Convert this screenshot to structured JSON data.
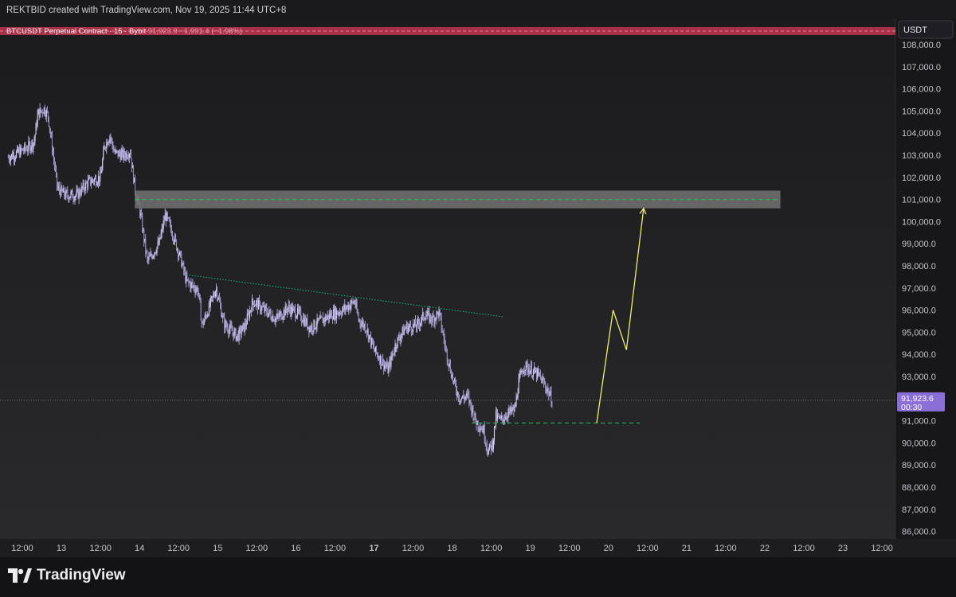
{
  "header": {
    "credit": "REKTBID created with TradingView.com, Nov 19, 2025 11:44 UTC+8"
  },
  "legend": {
    "symbol": "BTCUSDT Perpetual Contract · 15 · Bybit",
    "price": "91,923.9",
    "change": "−1,991.4 (−1.98%)"
  },
  "currency_label": "USDT",
  "price_tag": {
    "price": "91,923.6",
    "countdown": "00:30"
  },
  "footer": {
    "logo_text": "TradingView"
  },
  "colors": {
    "background": "#232325",
    "candle": "#b3a9dc",
    "zone_fill": "#6e6e6e",
    "zone_line": "#22c55e",
    "support_line": "#22c55e",
    "trendline": "#10b981",
    "projection": "#eef06b",
    "price_tag": "#8b6fd6",
    "legend_bar": "#c0344e"
  },
  "chart_data": {
    "type": "candlestick",
    "y_unit": "USDT",
    "ylim": [
      85300,
      109000
    ],
    "y_ticks": [
      86000,
      87000,
      88000,
      89000,
      90000,
      91000,
      92000,
      93000,
      94000,
      95000,
      96000,
      97000,
      98000,
      99000,
      100000,
      101000,
      102000,
      103000,
      104000,
      105000,
      106000,
      107000,
      108000
    ],
    "y_tick_labels": [
      "86,000.0",
      "87,000.0",
      "88,000.0",
      "89,000.0",
      "90,000.0",
      "91,000.0",
      "92,000.0",
      "93,000.0",
      "94,000.0",
      "95,000.0",
      "96,000.0",
      "97,000.0",
      "98,000.0",
      "99,000.0",
      "100,000.0",
      "101,000.0",
      "102,000.0",
      "103,000.0",
      "104,000.0",
      "105,000.0",
      "106,000.0",
      "107,000.0",
      "108,000.0"
    ],
    "x_ticks": [
      {
        "t": 0,
        "label": "12:00"
      },
      {
        "t": 0.5,
        "label": "13"
      },
      {
        "t": 1,
        "label": "12:00"
      },
      {
        "t": 1.5,
        "label": "14"
      },
      {
        "t": 2,
        "label": "12:00"
      },
      {
        "t": 2.5,
        "label": "15"
      },
      {
        "t": 3,
        "label": "12:00"
      },
      {
        "t": 3.5,
        "label": "16"
      },
      {
        "t": 4,
        "label": "12:00"
      },
      {
        "t": 4.5,
        "label": "17",
        "bold": true
      },
      {
        "t": 5,
        "label": "12:00"
      },
      {
        "t": 5.5,
        "label": "18"
      },
      {
        "t": 6,
        "label": "12:00"
      },
      {
        "t": 6.5,
        "label": "19"
      },
      {
        "t": 7,
        "label": "12:00"
      },
      {
        "t": 7.5,
        "label": "20"
      },
      {
        "t": 8,
        "label": "12:00"
      },
      {
        "t": 8.5,
        "label": "21"
      },
      {
        "t": 9,
        "label": "12:00"
      },
      {
        "t": 9.5,
        "label": "22"
      },
      {
        "t": 10,
        "label": "12:00"
      },
      {
        "t": 10.5,
        "label": "23"
      },
      {
        "t": 11,
        "label": "12:00"
      }
    ],
    "price_path": [
      [
        -0.18,
        102900
      ],
      [
        0.05,
        103300
      ],
      [
        0.15,
        103600
      ],
      [
        0.2,
        104900
      ],
      [
        0.28,
        105100
      ],
      [
        0.33,
        104800
      ],
      [
        0.45,
        101500
      ],
      [
        0.55,
        101200
      ],
      [
        0.7,
        101200
      ],
      [
        0.85,
        101800
      ],
      [
        1.0,
        102000
      ],
      [
        1.05,
        103400
      ],
      [
        1.12,
        103900
      ],
      [
        1.18,
        103100
      ],
      [
        1.3,
        103000
      ],
      [
        1.38,
        103200
      ],
      [
        1.44,
        101500
      ],
      [
        1.5,
        100600
      ],
      [
        1.6,
        98200
      ],
      [
        1.75,
        99000
      ],
      [
        1.83,
        100300
      ],
      [
        1.92,
        99500
      ],
      [
        2.02,
        98400
      ],
      [
        2.1,
        97300
      ],
      [
        2.25,
        96900
      ],
      [
        2.3,
        95300
      ],
      [
        2.4,
        96200
      ],
      [
        2.48,
        97000
      ],
      [
        2.58,
        95400
      ],
      [
        2.75,
        94800
      ],
      [
        2.85,
        95300
      ],
      [
        2.95,
        96400
      ],
      [
        3.1,
        96000
      ],
      [
        3.25,
        95600
      ],
      [
        3.4,
        96100
      ],
      [
        3.55,
        95800
      ],
      [
        3.68,
        95200
      ],
      [
        3.82,
        95500
      ],
      [
        3.95,
        95800
      ],
      [
        4.1,
        96000
      ],
      [
        4.25,
        96400
      ],
      [
        4.3,
        95600
      ],
      [
        4.4,
        95200
      ],
      [
        4.5,
        94200
      ],
      [
        4.6,
        93700
      ],
      [
        4.68,
        93300
      ],
      [
        4.78,
        94500
      ],
      [
        4.9,
        95200
      ],
      [
        5.05,
        95300
      ],
      [
        5.15,
        95800
      ],
      [
        5.25,
        95600
      ],
      [
        5.33,
        95900
      ],
      [
        5.42,
        94200
      ],
      [
        5.52,
        92700
      ],
      [
        5.6,
        92000
      ],
      [
        5.7,
        92100
      ],
      [
        5.8,
        91000
      ],
      [
        5.9,
        90600
      ],
      [
        5.96,
        89600
      ],
      [
        6.02,
        90000
      ],
      [
        6.06,
        91200
      ],
      [
        6.12,
        91000
      ],
      [
        6.2,
        91300
      ],
      [
        6.3,
        91500
      ],
      [
        6.35,
        92700
      ],
      [
        6.42,
        93500
      ],
      [
        6.5,
        93300
      ],
      [
        6.62,
        93000
      ],
      [
        6.72,
        92400
      ],
      [
        6.78,
        91900
      ]
    ],
    "resistance_zone": {
      "low": 100600,
      "high": 101400,
      "mid": 101000,
      "t_start": 1.44,
      "t_end": 9.7
    },
    "support_level": {
      "price": 90900,
      "t_start": 5.75,
      "t_end": 7.9
    },
    "trendline": {
      "points": [
        [
          2.1,
          97600
        ],
        [
          6.15,
          95700
        ]
      ]
    },
    "projection": {
      "points": [
        [
          7.35,
          90900
        ],
        [
          7.56,
          96000
        ],
        [
          7.73,
          94200
        ],
        [
          7.95,
          100600
        ]
      ]
    },
    "last_price": 91923.6
  }
}
